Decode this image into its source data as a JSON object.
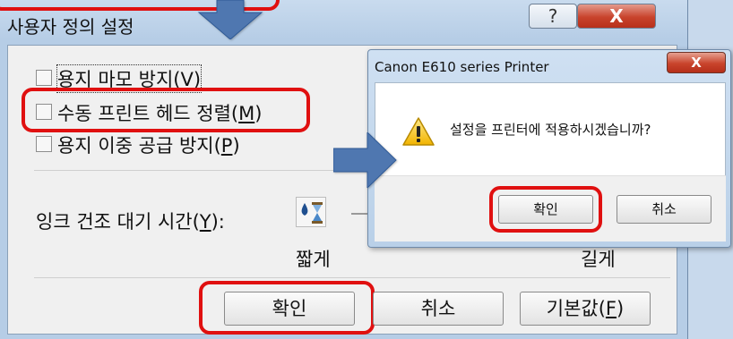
{
  "main_dialog": {
    "title": "사용자 정의 설정",
    "help_glyph": "?",
    "close_glyph": "X",
    "checkboxes": [
      {
        "label": "용지 마모 방지(",
        "accel": "V",
        "tail": ")",
        "checked": false
      },
      {
        "label": "수동 프린트 헤드 정렬(",
        "accel": "M",
        "tail": ")",
        "checked": false
      },
      {
        "label": "용지 이중 공급 방지(",
        "accel": "P",
        "tail": ")",
        "checked": false
      }
    ],
    "ink_dry_label": "잉크 건조 대기 시간(",
    "ink_dry_accel": "Y",
    "ink_dry_tail": "):",
    "slider_short_label": "짧게",
    "slider_long_label": "길게",
    "buttons": {
      "ok": "확인",
      "cancel": "취소",
      "default": "기본값(",
      "default_accel": "F",
      "default_tail": ")"
    }
  },
  "confirm_dialog": {
    "title": "Canon E610 series Printer",
    "close_glyph": "X",
    "message": "설정을 프린터에 적용하시겠습니까?",
    "icon": "warning-icon",
    "ok": "확인",
    "cancel": "취소"
  },
  "annotation_color": "#e01010",
  "arrow_color": "#4f77b0"
}
